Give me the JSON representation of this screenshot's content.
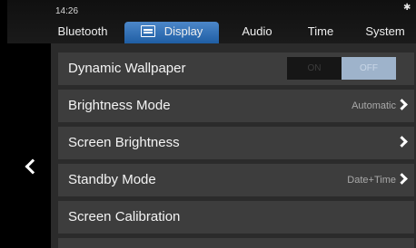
{
  "status": {
    "time": "14:26",
    "bluetooth_icon": "bluetooth-icon"
  },
  "tabs": [
    {
      "label": "Bluetooth",
      "active": false
    },
    {
      "label": "Display",
      "active": true,
      "icon": "display-icon"
    },
    {
      "label": "Audio",
      "active": false
    },
    {
      "label": "Time",
      "active": false
    },
    {
      "label": "System",
      "active": false
    }
  ],
  "settings": [
    {
      "label": "Dynamic Wallpaper",
      "toggle": {
        "on_label": "ON",
        "off_label": "OFF",
        "selected": "OFF"
      }
    },
    {
      "label": "Brightness Mode",
      "value": "Automatic"
    },
    {
      "label": "Screen Brightness",
      "value": ""
    },
    {
      "label": "Standby Mode",
      "value": "Date+Time"
    },
    {
      "label": "Screen Calibration"
    }
  ],
  "colors": {
    "active_tab": "#2f6fb5",
    "row_background": "#3d3d3d",
    "toggle_selected": "#9eb3cb"
  }
}
